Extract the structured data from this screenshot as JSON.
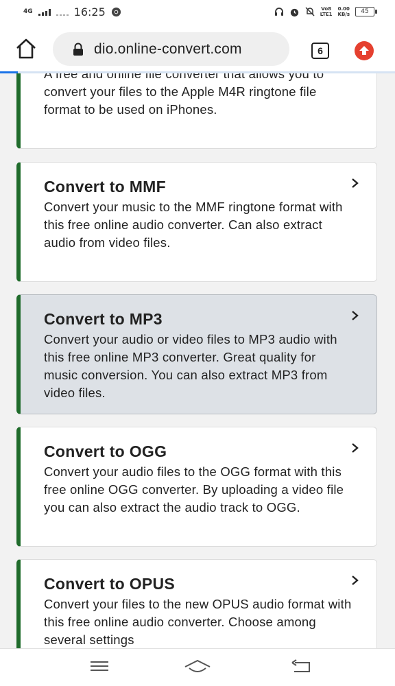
{
  "status_bar": {
    "network": "4G",
    "time": "16:25",
    "volte": "Vo8",
    "volte_sub": "LTE1",
    "speed": "0.00",
    "speed_unit": "KB/s",
    "battery": "45"
  },
  "browser": {
    "url": "dio.online-convert.com",
    "tab_count": "6"
  },
  "cards": [
    {
      "title": "",
      "desc": "A free and online file converter that allows you to convert your files to the Apple M4R ringtone file format to be used on iPhones."
    },
    {
      "title": "Convert to MMF",
      "desc": "Convert your music to the MMF ringtone format with this free online audio converter. Can also extract audio from video files."
    },
    {
      "title": "Convert to MP3",
      "desc": "Convert your audio or video files to MP3 audio with this free online MP3 converter. Great quality for music conversion. You can also extract MP3 from video files."
    },
    {
      "title": "Convert to OGG",
      "desc": "Convert your audio files to the OGG format with this free online OGG converter. By uploading a video file you can also extract the audio track to OGG."
    },
    {
      "title": "Convert to OPUS",
      "desc": "Convert your files to the new OPUS audio format with this free online audio converter. Choose among several settings"
    }
  ]
}
